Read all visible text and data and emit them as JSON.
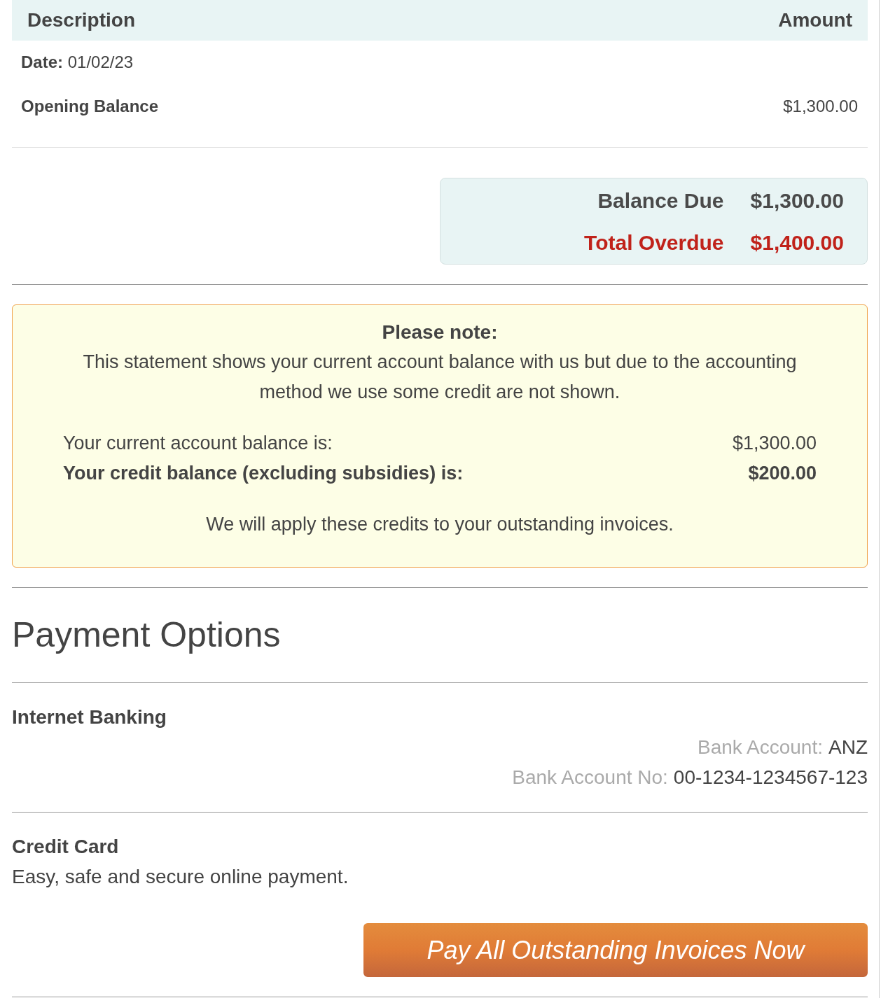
{
  "table": {
    "columns": [
      "Description",
      "Amount"
    ],
    "rows": [
      {
        "kind": "date",
        "text": "**Date:** 01/02/23"
      },
      {
        "kind": "line",
        "label": "Opening Balance",
        "amount": "$1,300.00"
      }
    ]
  },
  "summary": {
    "rows": [
      {
        "kind": "normal",
        "label": "Balance Due",
        "amount": "$1,300.00"
      },
      {
        "kind": "overdue",
        "label": "Total Overdue",
        "amount": "$1,400.00"
      }
    ]
  },
  "note": {
    "title": "Please note:",
    "message": "This statement shows your current account balance with us but due to the accounting method we use some credit are not shown.",
    "lines": [
      {
        "label": "Your current account balance is:",
        "amount": "$1,300.00",
        "bold": false
      },
      {
        "label": "Your credit balance (excluding subsidies) is:",
        "amount": "$200.00",
        "bold": true
      }
    ],
    "footer": "We will apply these credits to your outstanding invoices."
  },
  "payment_options": {
    "title": "Payment Options",
    "methods": [
      {
        "kind": "bank",
        "title": "Internet Banking",
        "details": [
          {
            "label": "Bank Account:",
            "value": "ANZ"
          },
          {
            "label": "Bank Account No:",
            "value": "00-1234-1234567-123"
          }
        ]
      },
      {
        "kind": "card",
        "title": "Credit Card",
        "description": "Easy, safe and secure online payment.",
        "button": "Pay All Outstanding Invoices Now"
      }
    ]
  }
}
